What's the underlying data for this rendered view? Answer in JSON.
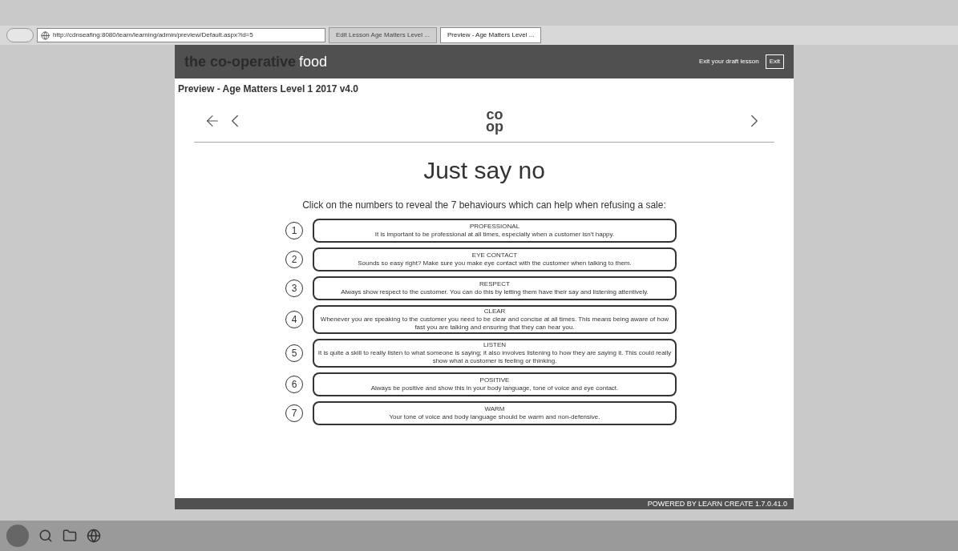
{
  "browser": {
    "address": "http://cdnseafing:8080/learn/learning/admin/preview/Default.aspx?id=5",
    "tabs": [
      {
        "label": "Edit Lesson Age Matters Level ...",
        "selected": false
      },
      {
        "label": "Preview - Age Matters Level ...",
        "selected": true
      }
    ]
  },
  "header": {
    "logo_prefix": "the co-operative",
    "logo_suffix": "food",
    "user": "Exit your draft lesson",
    "exit_button": "Exit"
  },
  "preview_title": "Preview - Age Matters Level 1 2017 v4.0",
  "slide": {
    "logo_top": "co",
    "logo_bottom": "op",
    "title": "Just say no",
    "instruction": "Click on the numbers to reveal the 7 behaviours which can help when refusing a sale:",
    "behaviours": [
      {
        "number": "1",
        "heading": "PROFESSIONAL",
        "text": "It is important to be professional at all times, especially when a customer isn't happy."
      },
      {
        "number": "2",
        "heading": "EYE CONTACT",
        "text": "Sounds so easy right? Make sure you make eye contact with the customer when talking to them."
      },
      {
        "number": "3",
        "heading": "RESPECT",
        "text": "Always show respect to the customer. You can do this by letting them have their say and listening attentively."
      },
      {
        "number": "4",
        "heading": "CLEAR",
        "text": "Whenever you are speaking to the customer you need to be clear and concise at all times. This means being aware of how fast you are talking and ensuring that they can hear you."
      },
      {
        "number": "5",
        "heading": "LISTEN",
        "text": "It is quite a skill to really listen to what someone is saying; it also involves listening to how they are saying it. This could really show what a customer is feeling or thinking."
      },
      {
        "number": "6",
        "heading": "POSITIVE",
        "text": "Always be positive and show this in your body language, tone of voice and eye contact."
      },
      {
        "number": "7",
        "heading": "WARM",
        "text": "Your tone of voice and body language should be warm and non-defensive."
      }
    ]
  },
  "footer": "POWERED BY LEARN CREATE 1.7.0.41.0"
}
